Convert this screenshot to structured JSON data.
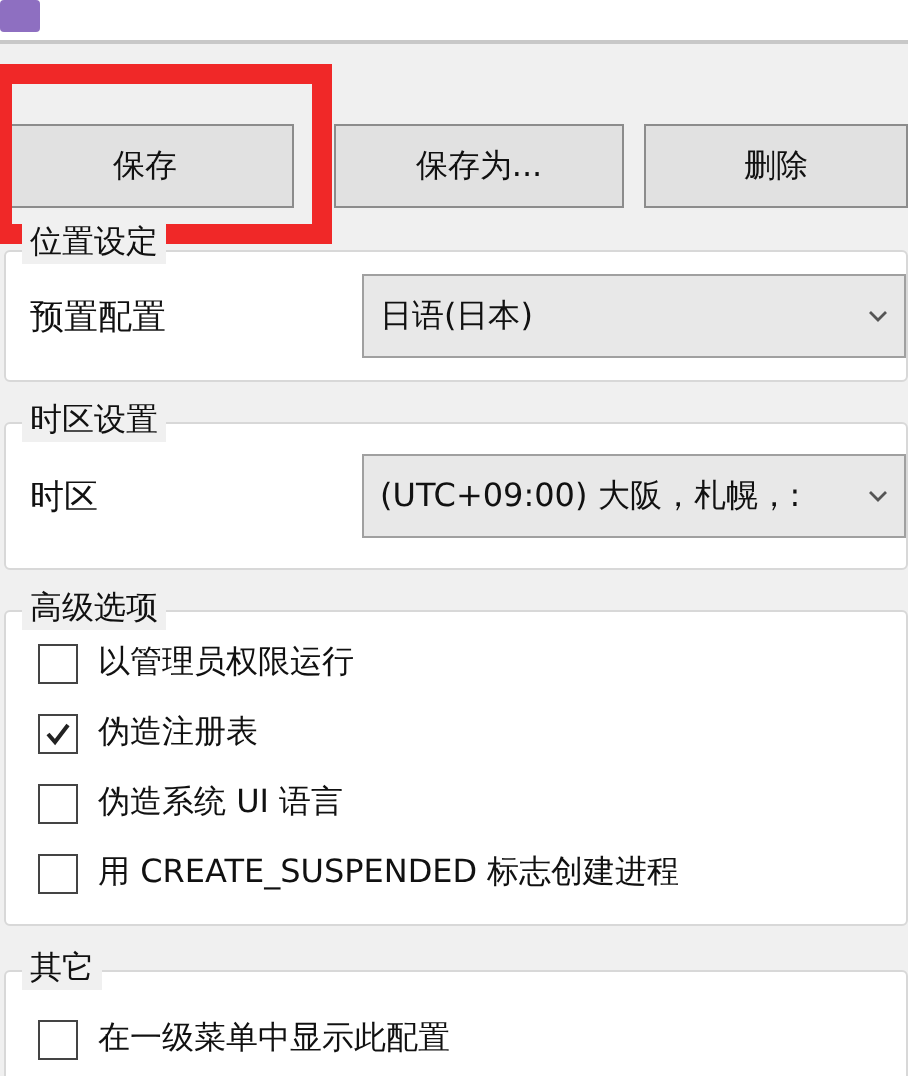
{
  "buttons": [
    {
      "label": "保存",
      "highlighted": true
    },
    {
      "label": "保存为...",
      "highlighted": false
    },
    {
      "label": "删除",
      "highlighted": false
    }
  ],
  "groups": [
    {
      "title": "位置设定",
      "kind": "select",
      "label": "预置配置",
      "value": "日语(日本)"
    },
    {
      "title": "时区设置",
      "kind": "select",
      "label": "时区",
      "value": "(UTC+09:00) 大阪，札幌，:"
    },
    {
      "title": "高级选项",
      "kind": "checks",
      "options": [
        {
          "label": "以管理员权限运行",
          "checked": false
        },
        {
          "label": "伪造注册表",
          "checked": true
        },
        {
          "label": "伪造系统 UI 语言",
          "checked": false
        },
        {
          "label": "用 CREATE_SUSPENDED 标志创建进程",
          "checked": false
        }
      ]
    },
    {
      "title": "其它",
      "kind": "checks",
      "options": [
        {
          "label": "在一级菜单中显示此配置",
          "checked": false
        }
      ]
    }
  ]
}
